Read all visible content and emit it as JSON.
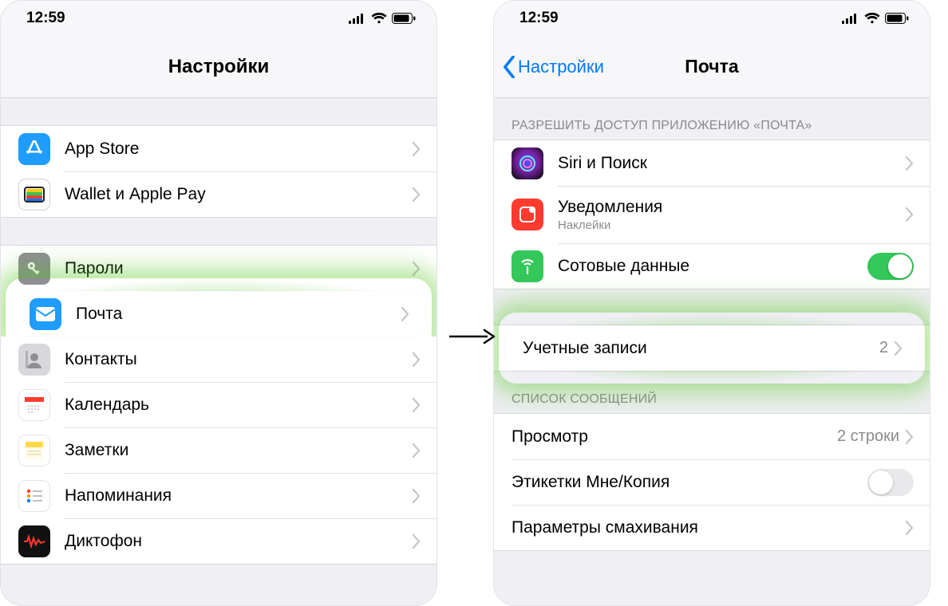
{
  "status": {
    "time": "12:59"
  },
  "phone1": {
    "title": "Настройки",
    "group_top": [
      {
        "icon": "appstore",
        "label": "App Store"
      },
      {
        "icon": "wallet",
        "label": "Wallet и Apple Pay"
      }
    ],
    "group_main": [
      {
        "icon": "passwords",
        "label": "Пароли"
      },
      {
        "icon": "mail",
        "label": "Почта",
        "highlight": true
      },
      {
        "icon": "contacts",
        "label": "Контакты"
      },
      {
        "icon": "calendar",
        "label": "Календарь"
      },
      {
        "icon": "notes",
        "label": "Заметки"
      },
      {
        "icon": "reminders",
        "label": "Напоминания"
      },
      {
        "icon": "voice",
        "label": "Диктофон"
      }
    ]
  },
  "phone2": {
    "back": "Настройки",
    "title": "Почта",
    "section_access_header": "РАЗРЕШИТЬ ДОСТУП ПРИЛОЖЕНИЮ «ПОЧТА»",
    "access_rows": {
      "siri": {
        "label": "Siri и Поиск"
      },
      "notif": {
        "label": "Уведомления",
        "sub": "Наклейки"
      },
      "cell": {
        "label": "Сотовые данные",
        "toggle": true
      }
    },
    "accounts": {
      "label": "Учетные записи",
      "count": "2"
    },
    "section_messages_header": "СПИСОК СООБЩЕНИЙ",
    "messages_rows": {
      "preview": {
        "label": "Просмотр",
        "detail": "2 строки"
      },
      "labels": {
        "label": "Этикетки Мне/Копия",
        "toggle": false
      },
      "swipe": {
        "label": "Параметры смахивания"
      }
    }
  }
}
